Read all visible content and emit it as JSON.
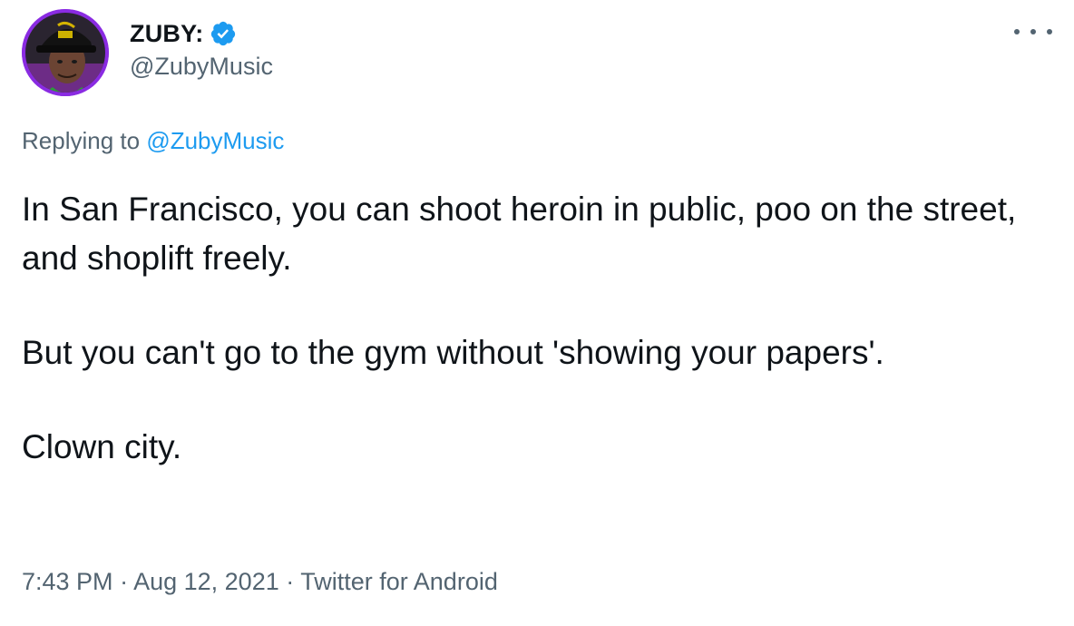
{
  "author": {
    "display_name": "ZUBY:",
    "handle": "@ZubyMusic",
    "verified": true
  },
  "reply": {
    "prefix": "Replying to ",
    "mention": "@ZubyMusic"
  },
  "tweet": {
    "paragraphs": [
      "In San Francisco, you can shoot heroin in public, poo on the street, and shoplift freely.",
      "But you can't go to the gym without 'showing your papers'.",
      "Clown city."
    ]
  },
  "meta": {
    "time": "7:43 PM",
    "separator": " · ",
    "date": "Aug 12, 2021",
    "source": "Twitter for Android"
  },
  "icons": {
    "verified": "verified-badge-icon",
    "more": "more-options-icon"
  },
  "colors": {
    "text": "#0f1419",
    "secondary": "#536471",
    "link": "#1d9bf0",
    "avatar_ring": "#8a2be2"
  }
}
